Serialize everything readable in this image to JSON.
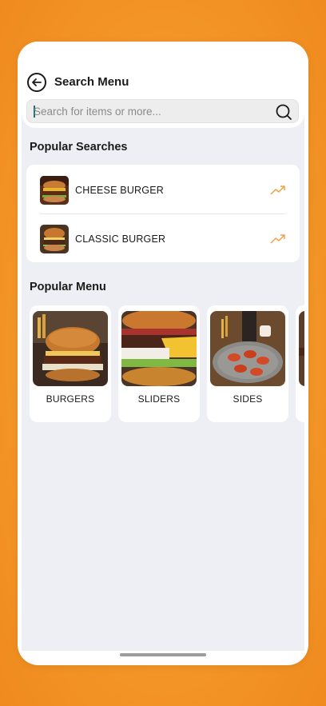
{
  "header": {
    "title": "Search Menu",
    "back_icon": "arrow-left-circle-icon"
  },
  "search": {
    "placeholder": "Search for items or more...",
    "value": "",
    "icon": "search-icon"
  },
  "popular_searches": {
    "title": "Popular Searches",
    "items": [
      {
        "label": "CHEESE BURGER",
        "image": "cheese-burger-photo",
        "icon": "trending-up-icon"
      },
      {
        "label": "CLASSIC BURGER",
        "image": "classic-burger-photo",
        "icon": "trending-up-icon"
      }
    ]
  },
  "popular_menu": {
    "title": "Popular Menu",
    "items": [
      {
        "label": "BURGERS",
        "image": "burgers-photo"
      },
      {
        "label": "SLIDERS",
        "image": "sliders-photo"
      },
      {
        "label": "SIDES",
        "image": "sides-photo"
      },
      {
        "label": "",
        "image": "partially-visible-photo"
      }
    ]
  },
  "colors": {
    "background": "#F49628",
    "screen": "#EEEFF4",
    "trend_accent": "#F0A146",
    "text": "#1A1A1A"
  }
}
